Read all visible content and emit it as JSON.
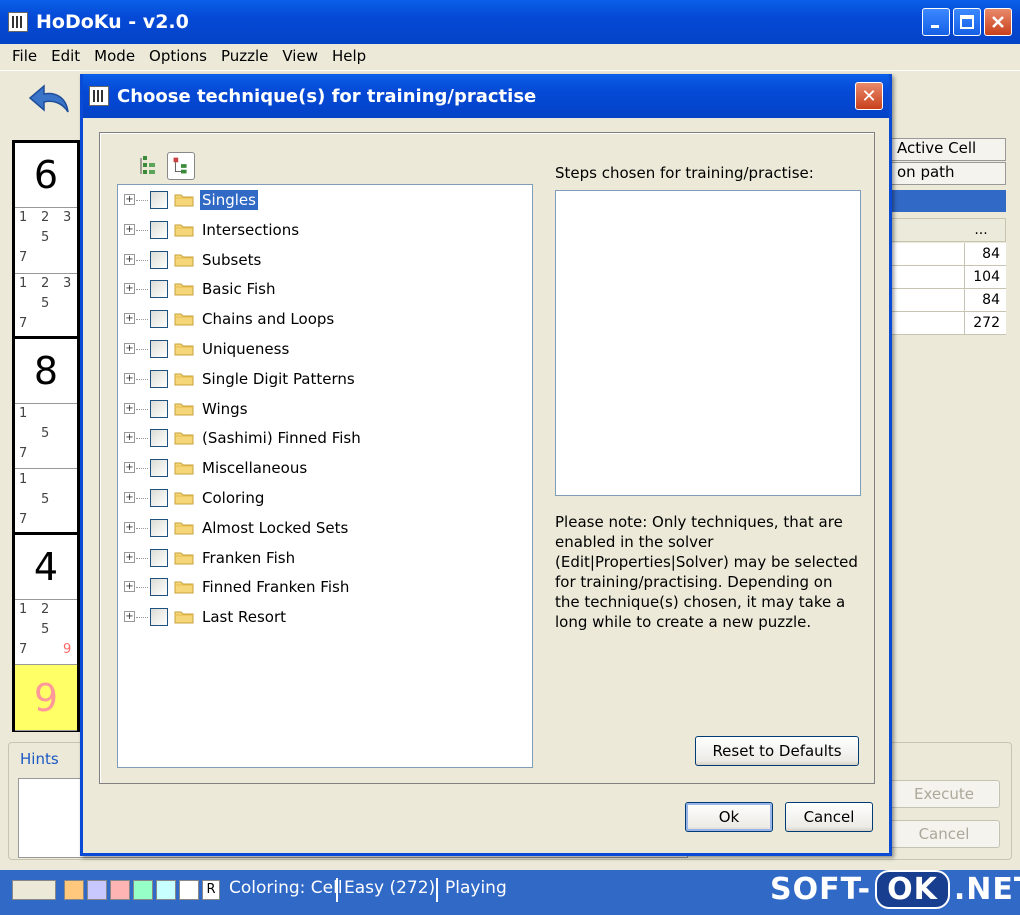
{
  "app": {
    "title": "HoDoKu - v2.0"
  },
  "menu": [
    "File",
    "Edit",
    "Mode",
    "Options",
    "Puzzle",
    "View",
    "Help"
  ],
  "grid": {
    "cells": [
      {
        "type": "big",
        "value": "6"
      },
      {
        "type": "cand",
        "cands": [
          "1",
          "2",
          "3",
          "5",
          "7"
        ]
      },
      {
        "type": "cand",
        "cands": [
          "1",
          "2",
          "3",
          "5",
          "7"
        ]
      },
      {
        "type": "big",
        "value": "8"
      },
      {
        "type": "cand",
        "cands": [
          "1",
          "5",
          "7"
        ]
      },
      {
        "type": "cand",
        "cands": [
          "1",
          "5",
          "7"
        ]
      },
      {
        "type": "big",
        "value": "4"
      },
      {
        "type": "cand",
        "cands": [
          "1",
          "2",
          "5",
          "7",
          "9"
        ]
      },
      {
        "type": "big",
        "value": "9",
        "selected": true
      }
    ]
  },
  "right_panel": {
    "tabs": [
      "Active Cell",
      "on path"
    ],
    "header_dots": "...",
    "values": [
      "84",
      "104",
      "84",
      "272"
    ]
  },
  "hints": {
    "label": "Hints"
  },
  "side_buttons": {
    "execute": "Execute",
    "cancel": "Cancel"
  },
  "status": {
    "swatches": [
      "#ece9d8",
      "#ffc87c",
      "#c8c8ff",
      "#ffb4b4",
      "#96ffc8",
      "#c8ffff",
      "#ffffff"
    ],
    "reset_key": "R",
    "coloring": "Coloring: Cell",
    "level": "Easy (272)",
    "mode": "Playing"
  },
  "watermark": {
    "left": "SOFT-",
    "mid": "OK",
    "right": ".NET"
  },
  "dialog": {
    "title": "Choose technique(s) for training/practise",
    "close": "✕",
    "tree": [
      {
        "label": "Singles",
        "selected": true
      },
      {
        "label": "Intersections"
      },
      {
        "label": "Subsets"
      },
      {
        "label": "Basic Fish"
      },
      {
        "label": "Chains and Loops"
      },
      {
        "label": "Uniqueness"
      },
      {
        "label": "Single Digit Patterns"
      },
      {
        "label": "Wings"
      },
      {
        "label": "(Sashimi) Finned Fish"
      },
      {
        "label": "Miscellaneous"
      },
      {
        "label": "Coloring"
      },
      {
        "label": "Almost Locked Sets"
      },
      {
        "label": "Franken Fish"
      },
      {
        "label": "Finned Franken Fish"
      },
      {
        "label": "Last Resort"
      }
    ],
    "steps_label": "Steps chosen for training/practise:",
    "note": "Please note: Only techniques, that are enabled in the solver (Edit|Properties|Solver) may be selected for training/practising. Depending on the technique(s) chosen, it may take a long while to create a new puzzle.",
    "reset_button": "Reset to Defaults",
    "ok_button": "Ok",
    "cancel_button": "Cancel"
  }
}
